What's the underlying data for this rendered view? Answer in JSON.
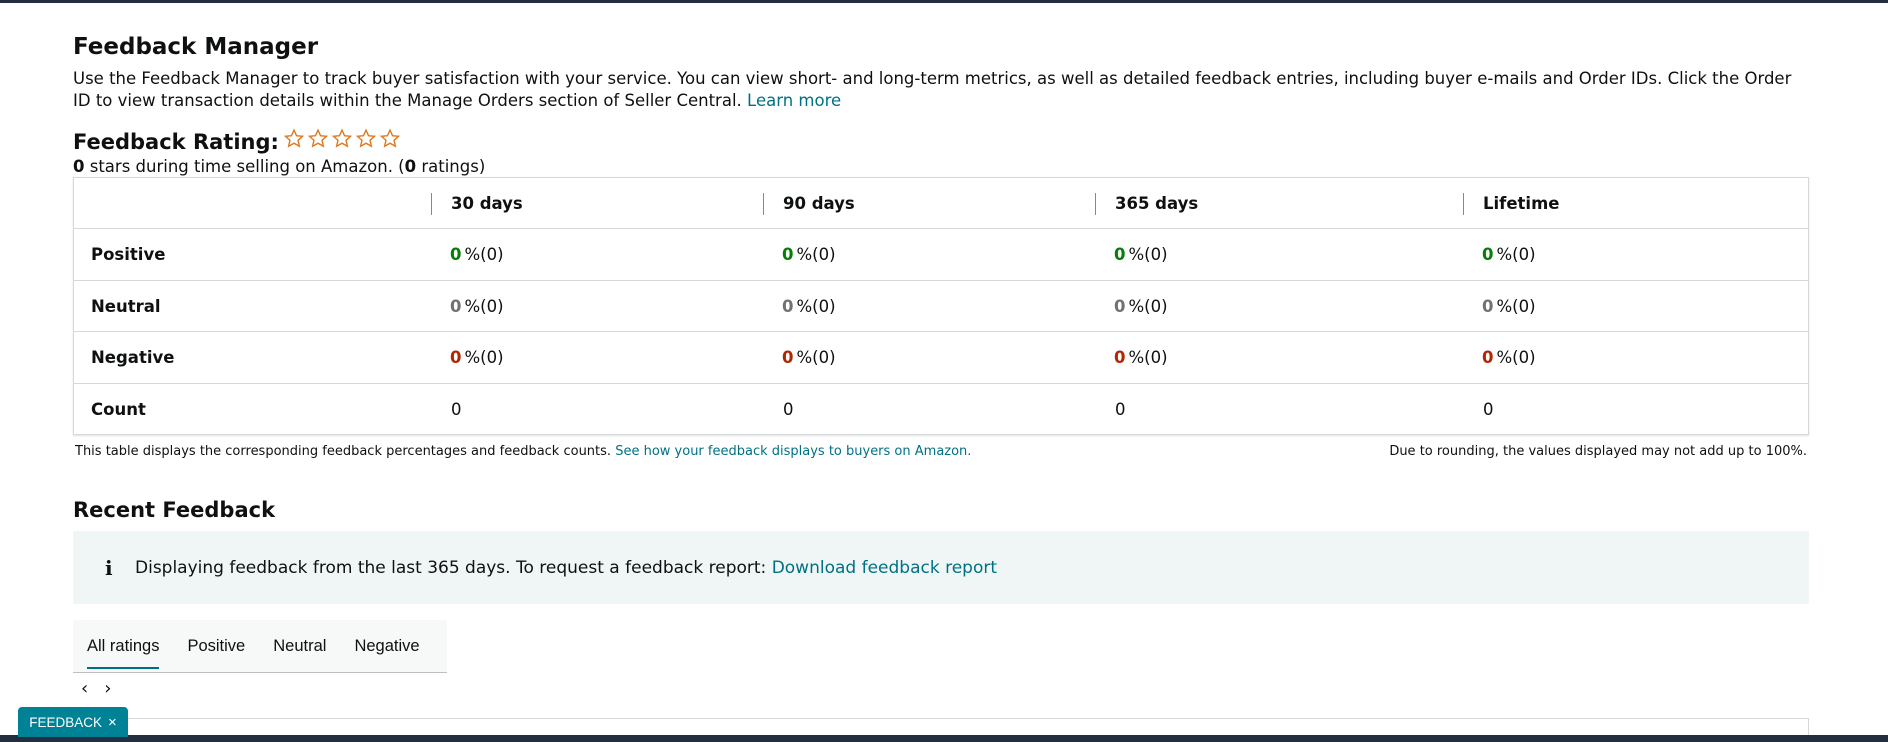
{
  "page": {
    "title": "Feedback Manager",
    "description": "Use the Feedback Manager to track buyer satisfaction with your service. You can view short- and long-term metrics, as well as detailed feedback entries, including buyer e-mails and Order IDs. Click the Order ID to view transaction details within the Manage Orders section of Seller Central.",
    "learn_more": "Learn more"
  },
  "rating": {
    "label": "Feedback Rating:",
    "stars_value": "0",
    "stars_text": " stars during time selling on Amazon. (",
    "ratings_value": "0",
    "ratings_text": " ratings)",
    "star_color": "#de7921"
  },
  "table": {
    "headers": [
      "30 days",
      "90 days",
      "365 days",
      "Lifetime"
    ],
    "rows": {
      "positive": {
        "label": "Positive",
        "values": [
          "0",
          "0",
          "0",
          "0"
        ],
        "counts": [
          "%(0)",
          "%(0)",
          "%(0)",
          "%(0)"
        ]
      },
      "neutral": {
        "label": "Neutral",
        "values": [
          "0",
          "0",
          "0",
          "0"
        ],
        "counts": [
          "%(0)",
          "%(0)",
          "%(0)",
          "%(0)"
        ]
      },
      "negative": {
        "label": "Negative",
        "values": [
          "0",
          "0",
          "0",
          "0"
        ],
        "counts": [
          "%(0)",
          "%(0)",
          "%(0)",
          "%(0)"
        ]
      },
      "count": {
        "label": "Count",
        "values": [
          "0",
          "0",
          "0",
          "0"
        ]
      }
    },
    "note_left": "This table displays the corresponding feedback percentages and feedback counts.",
    "note_link": "See how your feedback displays to buyers on Amazon.",
    "note_right": "Due to rounding, the values displayed may not add up to 100%."
  },
  "recent": {
    "title": "Recent Feedback",
    "info_text": "Displaying feedback from the last 365 days. To request a feedback report:",
    "info_link": "Download feedback report",
    "tabs": [
      "All ratings",
      "Positive",
      "Neutral",
      "Negative"
    ],
    "active_tab": "All ratings"
  },
  "feedback_tab": {
    "label": "FEEDBACK",
    "close": "×"
  },
  "colors": {
    "positive": "#067d06",
    "neutral": "#6f7373",
    "negative": "#b12704",
    "link": "#007185",
    "accent": "#008296"
  }
}
